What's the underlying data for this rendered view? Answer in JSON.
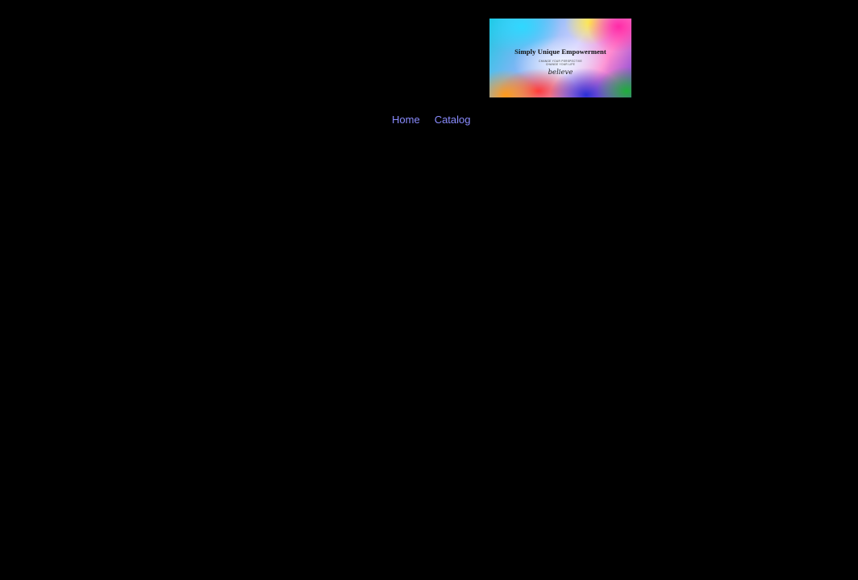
{
  "header": {
    "logo": {
      "title": "Simply Unique Empowerment",
      "tagline_line1": "CHANGE YOUR PERSPECTIVE",
      "tagline_line2": "CHANGE YOUR LIFE",
      "script_text": "believe"
    }
  },
  "nav": {
    "items": [
      {
        "label": "Home"
      },
      {
        "label": "Catalog"
      }
    ]
  },
  "colors": {
    "background": "#000000",
    "nav_link": "#8a8cff"
  }
}
